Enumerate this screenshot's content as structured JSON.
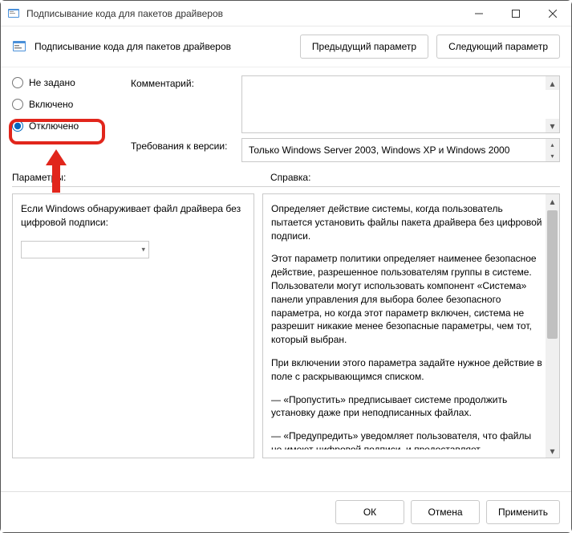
{
  "window": {
    "title": "Подписывание кода для пакетов драйверов"
  },
  "toolbar": {
    "title": "Подписывание кода для пакетов драйверов",
    "prev": "Предыдущий параметр",
    "next": "Следующий параметр"
  },
  "state": {
    "not_configured": "Не задано",
    "enabled": "Включено",
    "disabled": "Отключено"
  },
  "fields": {
    "comment_label": "Комментарий:",
    "requirements_label": "Требования к версии:",
    "requirements_value": "Только Windows Server 2003, Windows XP и Windows 2000"
  },
  "sections": {
    "params": "Параметры:",
    "help": "Справка:"
  },
  "params": {
    "text": "Если Windows обнаруживает файл драйвера без цифровой подписи:"
  },
  "help": {
    "p1": "Определяет действие системы, когда пользователь пытается установить файлы пакета драйвера без цифровой подписи.",
    "p2": "Этот параметр политики определяет наименее безопасное действие, разрешенное пользователям группы в системе. Пользователи могут использовать компонент «Система» панели управления для выбора более безопасного параметра, но когда этот параметр включен, система не разрешит никакие менее безопасные параметры, чем тот, который выбран.",
    "p3": "При включении этого параметра задайте нужное действие в поле с раскрывающимся списком.",
    "p4": "—   «Пропустить» предписывает системе продолжить установку даже при неподписанных файлах.",
    "p5": "—   «Предупредить» уведомляет пользователя, что файлы не имеют цифровой подписи, и предоставляет пользователю возможность решить, остановить установку или продолжить, и разрешить ли установку неподписанных файлов. Параметр"
  },
  "footer": {
    "ok": "ОК",
    "cancel": "Отмена",
    "apply": "Применить"
  }
}
